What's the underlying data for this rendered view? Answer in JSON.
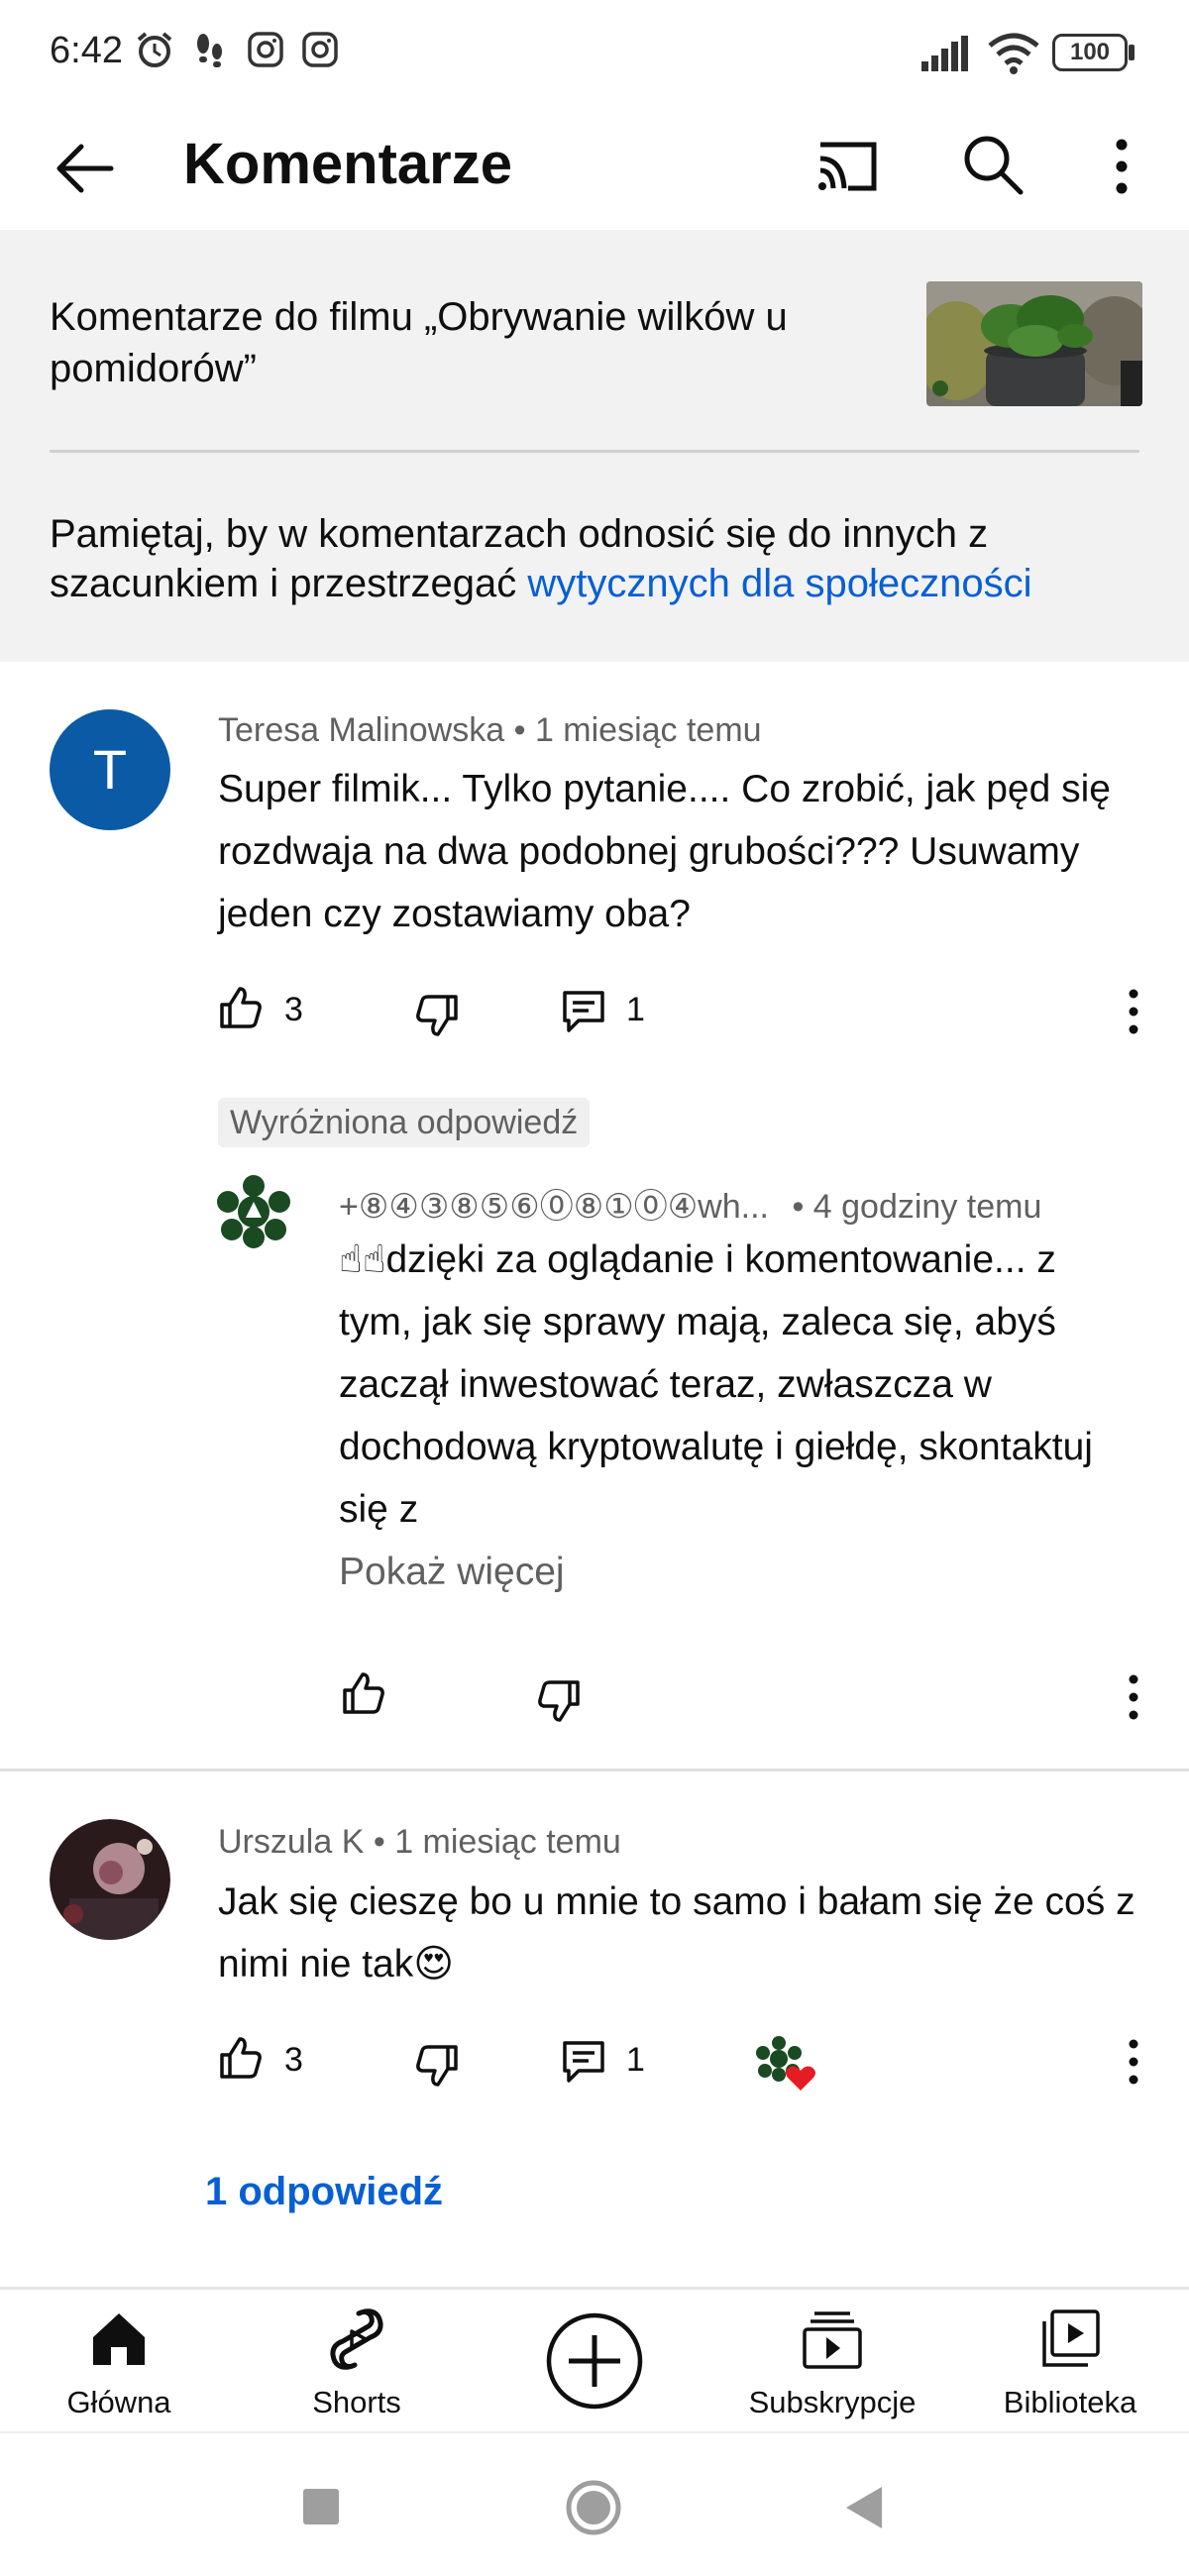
{
  "status_bar": {
    "time": "6:42",
    "battery": "100"
  },
  "app_bar": {
    "title": "Komentarze"
  },
  "header": {
    "video_title": "Komentarze do filmu „Obrywanie wilków u pomidorów”",
    "guidelines_text": "Pamiętaj, by w komentarzach odnosić się do innych z szacunkiem i przestrzegać ",
    "guidelines_link": "wytycznych dla społeczności"
  },
  "comments": [
    {
      "avatar_letter": "T",
      "avatar_color": "#0b5aa6",
      "author": "Teresa Malinowska",
      "time": "1 miesiąc temu",
      "text": "Super filmik... Tylko pytanie.... Co zrobić, jak pęd się rozdwaja na dwa podobnej grubości??? Usuwamy jeden czy zostawiamy oba?",
      "likes": "3",
      "replies": "1",
      "pinned_reply": {
        "chip": "Wyróżniona odpowiedź",
        "author": "+⑧④③⑧⑤⑥⓪⑧①⓪④wh...",
        "time": "4 godziny temu",
        "text": "☝☝dzięki za oglądanie i komentowanie... z tym, jak się sprawy mają, zaleca się, abyś zaczął inwestować teraz, zwłaszcza w dochodową kryptowalutę i giełdę, skontaktuj się z",
        "show_more": "Pokaż więcej"
      }
    },
    {
      "author": "Urszula K",
      "time": "1 miesiąc temu",
      "text": "Jak się cieszę bo u mnie to samo i bałam się że coś z nimi nie tak😍",
      "likes": "3",
      "replies": "1",
      "replies_link": "1 odpowiedź"
    }
  ],
  "bottom_nav": {
    "items": [
      {
        "label": "Główna",
        "icon": "home-icon"
      },
      {
        "label": "Shorts",
        "icon": "shorts-icon"
      },
      {
        "label": "",
        "icon": "create-icon"
      },
      {
        "label": "Subskrypcje",
        "icon": "subscriptions-icon"
      },
      {
        "label": "Biblioteka",
        "icon": "library-icon"
      }
    ]
  },
  "colors": {
    "link": "#065fd4",
    "meta": "#606060",
    "header_bg": "#f2f2f2"
  }
}
